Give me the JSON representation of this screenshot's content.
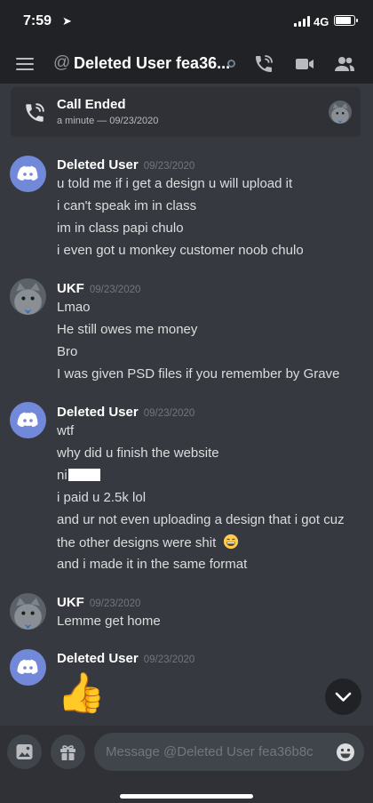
{
  "status_bar": {
    "time": "7:59",
    "network": "4G"
  },
  "header": {
    "title": "Deleted User fea36...",
    "icons": [
      "menu-icon",
      "at-icon",
      "status-dot",
      "call-icon",
      "video-icon",
      "members-icon"
    ]
  },
  "call_card": {
    "title": "Call Ended",
    "meta": "a minute — 09/23/2020"
  },
  "messages": [
    {
      "author": "Deleted User",
      "timestamp": "09/23/2020",
      "avatar": "discord-logo",
      "lines": [
        "u told me if i get a design u will upload it",
        "i can't speak im in class",
        "im in class papi chulo",
        "i even got u monkey customer noob chulo"
      ]
    },
    {
      "author": "UKF",
      "timestamp": "09/23/2020",
      "avatar": "cat-photo",
      "lines": [
        "Lmao",
        "He still owes me money",
        "Bro",
        "I was given PSD files if you remember by Grave"
      ]
    },
    {
      "author": "Deleted User",
      "timestamp": "09/23/2020",
      "avatar": "discord-logo",
      "lines": [
        "wtf",
        "why did u finish the website",
        "ni",
        "i paid u 2.5k lol",
        "and ur not even uploading a design that i got cuz",
        "the other designs were shit",
        "and i made it in the same format"
      ]
    },
    {
      "author": "UKF",
      "timestamp": "09/23/2020",
      "avatar": "cat-photo",
      "lines": [
        "Lemme get home"
      ]
    },
    {
      "author": "Deleted User",
      "timestamp": "09/23/2020",
      "avatar": "discord-logo",
      "lines": [
        "👍"
      ]
    }
  ],
  "composer": {
    "placeholder": "Message @Deleted User fea36b8c",
    "buttons": [
      "image-icon",
      "gift-icon",
      "emoji-icon"
    ]
  },
  "colors": {
    "background": "#36393f",
    "bar": "#202225",
    "card": "#2f3136",
    "input": "#40444b",
    "blurple": "#7289da"
  }
}
